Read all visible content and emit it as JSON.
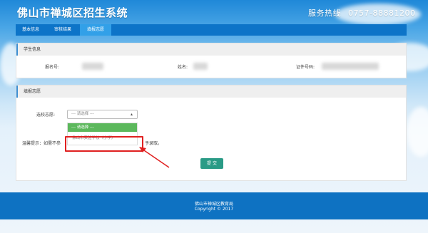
{
  "header": {
    "title": "佛山市禅城区招生系统",
    "hotline_label": "服务热线",
    "hotline_number": "0757-88881200"
  },
  "nav": {
    "tabs": [
      {
        "label": "基本信息"
      },
      {
        "label": "审核结果"
      },
      {
        "label": "填报志愿",
        "active": true
      }
    ]
  },
  "student_info": {
    "section_title": "学生信息",
    "fields": [
      {
        "label": "报名号:",
        "value": ""
      },
      {
        "label": "姓名:",
        "value": ""
      },
      {
        "label": "证件号码:",
        "value": ""
      }
    ]
  },
  "wish": {
    "section_title": "填报志愿",
    "school_label": "选校志愿:",
    "select_value": "--- 请选择 ---",
    "options": [
      "--- 请选择 ---",
      "佛山市实验学校（小学）"
    ],
    "hint_prefix": "温馨提示：如需不参",
    "hint_suffix": "予录取。",
    "submit_label": "提 交"
  },
  "footer": {
    "org": "佛山市禅城区教育局",
    "copyright": "Copyright © 2017"
  },
  "colors": {
    "nav_bg": "#0d74c8",
    "active_tab": "#32a0e8",
    "option_active": "#5cb85c",
    "submit_bg": "#2a9b86",
    "highlight": "#e02020",
    "footer_bg": "#0e72c2"
  }
}
